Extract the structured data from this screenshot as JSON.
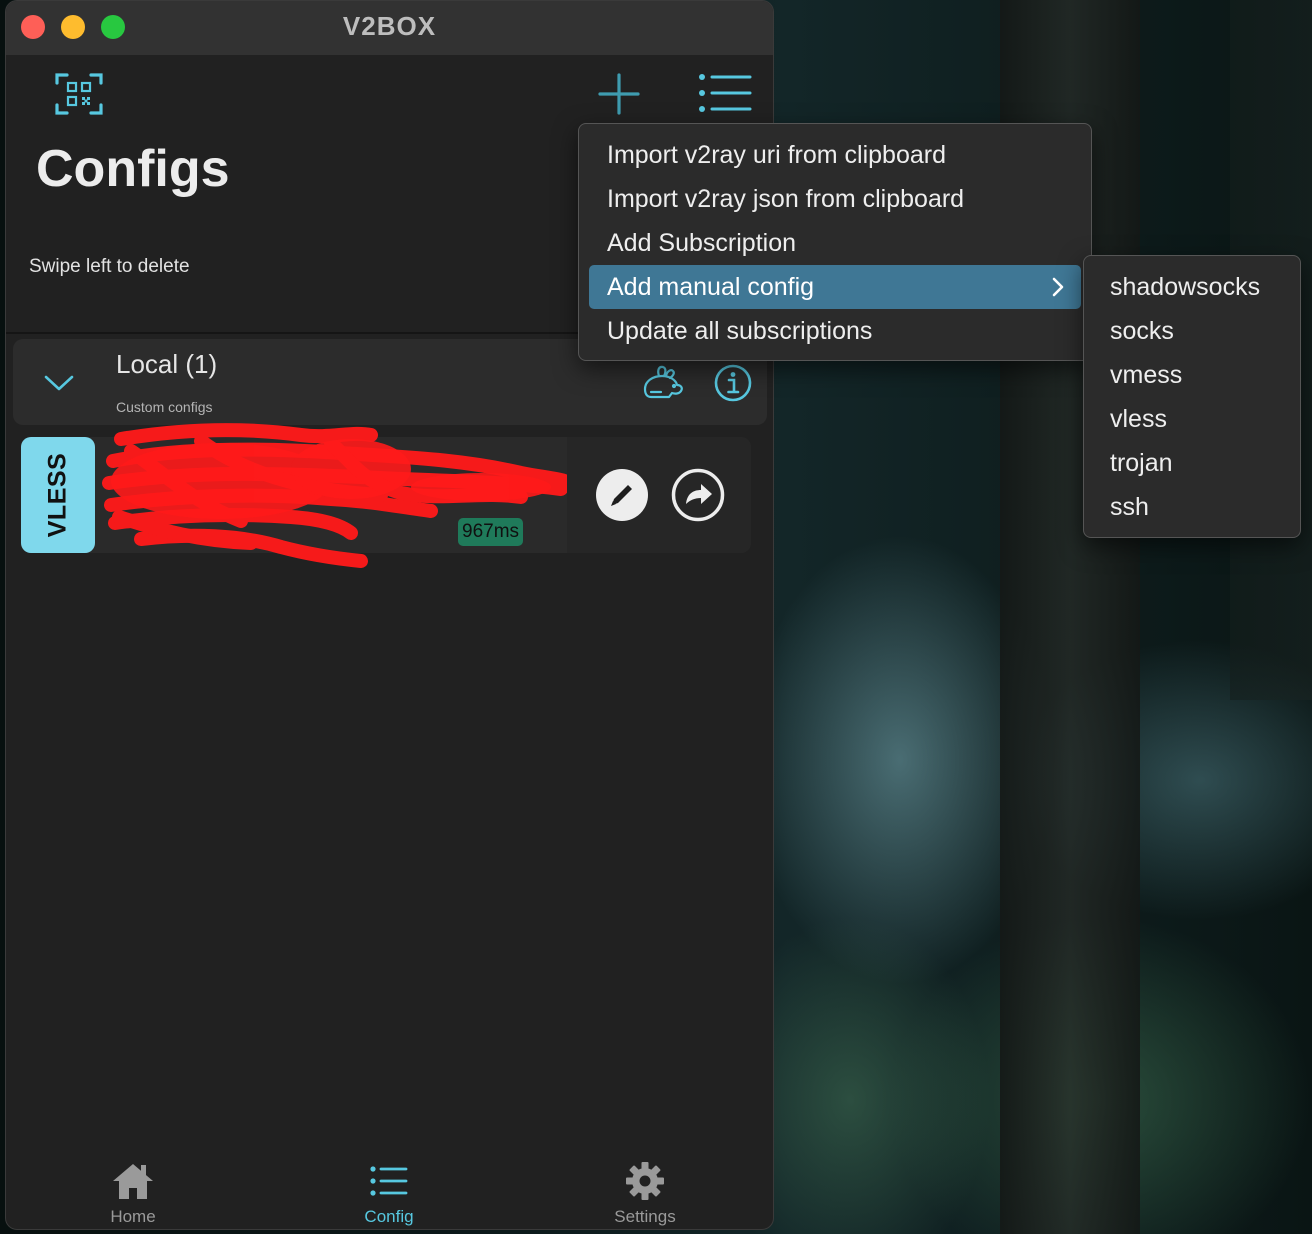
{
  "window": {
    "title": "V2BOX"
  },
  "header": {
    "title": "Configs",
    "hint": "Swipe left to delete",
    "icons": [
      "qr-code-scan-icon",
      "plus-icon",
      "list-icon"
    ]
  },
  "group": {
    "title": "Local (1)",
    "subtitle": "Custom configs",
    "icons": [
      "chevron-down-icon",
      "rabbit-speed-icon",
      "info-icon"
    ]
  },
  "config": {
    "protocol": "VLESS",
    "name": "",
    "latency": "967ms",
    "icons": [
      "pencil-icon",
      "share-arrow-icon"
    ]
  },
  "menu": {
    "items": [
      "Import v2ray uri from clipboard",
      "Import v2ray json from clipboard",
      "Add Subscription",
      "Add manual config",
      "Update all subscriptions"
    ],
    "active_index": 3
  },
  "submenu": {
    "items": [
      "shadowsocks",
      "socks",
      "vmess",
      "vless",
      "trojan",
      "ssh"
    ]
  },
  "tabs": [
    {
      "label": "Home",
      "icon": "home-icon"
    },
    {
      "label": "Config",
      "icon": "list-icon",
      "active": true
    },
    {
      "label": "Settings",
      "icon": "gear-icon"
    }
  ],
  "colors": {
    "accent": "#57c8e0",
    "badge": "#7fd8ec",
    "menu_highlight": "#3f7795",
    "latency": "#1f7a5a",
    "redaction": "#ff1a1a"
  }
}
